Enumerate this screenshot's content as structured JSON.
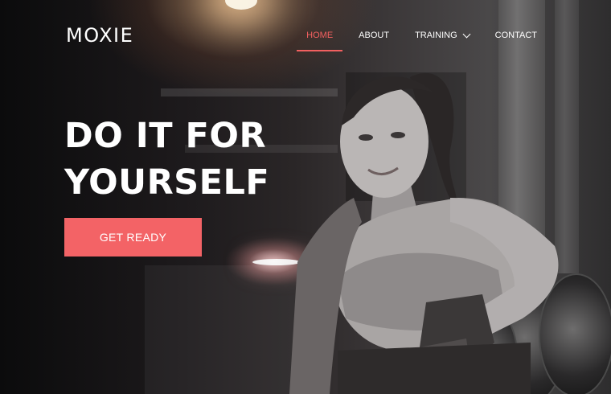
{
  "brand": {
    "name": "MOXIE"
  },
  "nav": {
    "items": [
      {
        "label": "HOME"
      },
      {
        "label": "ABOUT"
      },
      {
        "label": "TRAINING"
      },
      {
        "label": "CONTACT"
      }
    ],
    "active_index": 0,
    "active_color": "#f26060"
  },
  "hero": {
    "headline_line1": "DO IT FOR",
    "headline_line2": "YOURSELF",
    "cta_label": "GET READY",
    "cta_color": "#f36366"
  },
  "icons": {
    "training_dropdown": "chevron-down-icon"
  }
}
